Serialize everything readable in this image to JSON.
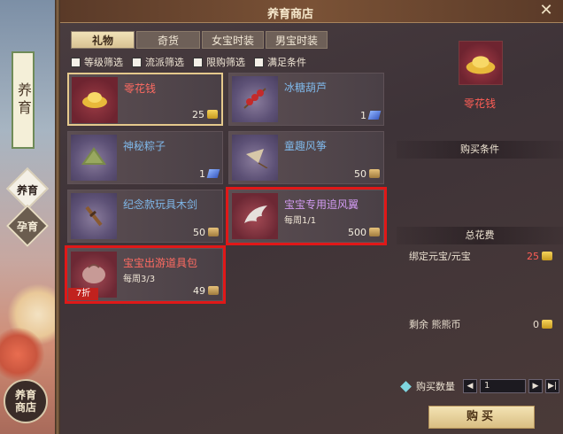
{
  "side_panel": {
    "scroll_label": "养育",
    "nav_a": "养育",
    "nav_b": "孕育",
    "nav_c_line1": "养育",
    "nav_c_line2": "商店"
  },
  "window": {
    "title": "养育商店",
    "close_glyph": "✕"
  },
  "tabs": [
    {
      "label": "礼物",
      "active": true
    },
    {
      "label": "奇货",
      "active": false
    },
    {
      "label": "女宝时装",
      "active": false
    },
    {
      "label": "男宝时装",
      "active": false
    }
  ],
  "filters": [
    "等级筛选",
    "流派筛选",
    "限购筛选",
    "满足条件"
  ],
  "items": [
    {
      "name": "零花钱",
      "sub": "",
      "price": "25",
      "currency": "gold",
      "state": "selected",
      "icon": "gold-ingot-icon"
    },
    {
      "name": "冰糖葫芦",
      "sub": "",
      "price": "1",
      "currency": "blue",
      "state": "normal",
      "icon": "candied-haws-icon"
    },
    {
      "name": "神秘粽子",
      "sub": "",
      "price": "1",
      "currency": "blue",
      "state": "normal",
      "icon": "zongzi-icon"
    },
    {
      "name": "童趣风筝",
      "sub": "",
      "price": "50",
      "currency": "coin",
      "state": "normal",
      "icon": "kite-icon"
    },
    {
      "name": "纪念款玩具木剑",
      "sub": "",
      "price": "50",
      "currency": "coin",
      "state": "normal",
      "icon": "wooden-sword-icon"
    },
    {
      "name": "宝宝专用追风翼",
      "sub": "每周1/1",
      "price": "500",
      "currency": "coin",
      "state": "highlight",
      "icon": "wing-icon"
    },
    {
      "name": "宝宝出游道具包",
      "sub": "每周3/3",
      "price": "49",
      "currency": "coin",
      "state": "highlight",
      "icon": "bag-icon",
      "discount": "7折"
    }
  ],
  "detail": {
    "name": "零花钱",
    "purchase_conditions": "购买条件",
    "total_cost": "总花费",
    "cost_label": "绑定元宝/元宝",
    "cost_value": "25",
    "remaining_label": "剩余 熊熊币",
    "remaining_value": "0",
    "qty_label": "购买数量",
    "qty_value": "1",
    "buy_label": "购买"
  }
}
